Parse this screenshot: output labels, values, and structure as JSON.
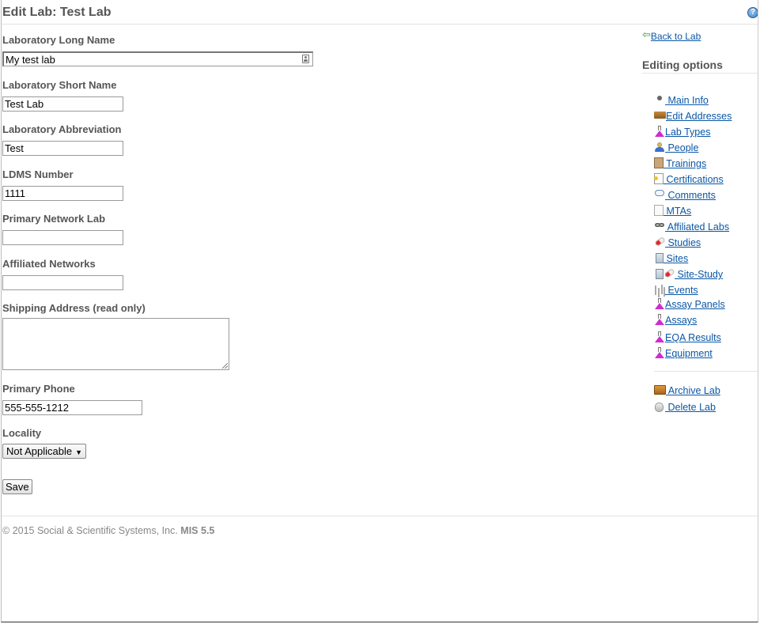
{
  "page": {
    "title": "Edit Lab: Test Lab"
  },
  "form": {
    "long_name": {
      "label": "Laboratory Long Name",
      "value": "My test lab"
    },
    "short_name": {
      "label": "Laboratory Short Name",
      "value": "Test Lab"
    },
    "abbreviation": {
      "label": "Laboratory Abbreviation",
      "value": "Test"
    },
    "ldms_number": {
      "label": "LDMS Number",
      "value": "1111"
    },
    "primary_network_lab": {
      "label": "Primary Network Lab",
      "value": ""
    },
    "affiliated_networks": {
      "label": "Affiliated Networks",
      "value": ""
    },
    "shipping_address": {
      "label": "Shipping Address (read only)",
      "value": ""
    },
    "primary_phone": {
      "label": "Primary Phone",
      "value": "555-555-1212"
    },
    "locality": {
      "label": "Locality",
      "value": "Not Applicable"
    },
    "save_label": "Save"
  },
  "sidebar": {
    "back_link": "Back to Lab",
    "title": "Editing options",
    "items": [
      {
        "label": " Main Info",
        "icon": "bullet-icon"
      },
      {
        "label": "Edit Addresses",
        "icon": "truck-icon"
      },
      {
        "label": "Lab Types",
        "icon": "flask-icon"
      },
      {
        "label": " People",
        "icon": "person-icon"
      },
      {
        "label": " Trainings",
        "icon": "training-icon"
      },
      {
        "label": " Certifications",
        "icon": "certificate-icon"
      },
      {
        "label": " Comments",
        "icon": "comment-icon"
      },
      {
        "label": " MTAs",
        "icon": "document-icon"
      },
      {
        "label": " Affiliated Labs",
        "icon": "link-icon"
      },
      {
        "label": " Studies",
        "icon": "pill-icon"
      },
      {
        "label": " Sites",
        "icon": "building-icon"
      },
      {
        "label": " Site-Study",
        "icon": "building-pill-icon"
      },
      {
        "label": " Events",
        "icon": "chart-icon"
      },
      {
        "label": "Assay Panels",
        "icon": "flask-icon"
      },
      {
        "label": "Assays",
        "icon": "flask-icon"
      },
      {
        "label": "EQA Results",
        "icon": "flask-icon"
      },
      {
        "label": "Equipment",
        "icon": "flask-icon"
      }
    ],
    "actions": [
      {
        "label": " Archive Lab",
        "icon": "archive-icon"
      },
      {
        "label": " Delete Lab",
        "icon": "delete-icon"
      }
    ]
  },
  "footer": {
    "copyright": "© 2015 Social & Scientific Systems, Inc.",
    "version": "MIS 5.5"
  }
}
